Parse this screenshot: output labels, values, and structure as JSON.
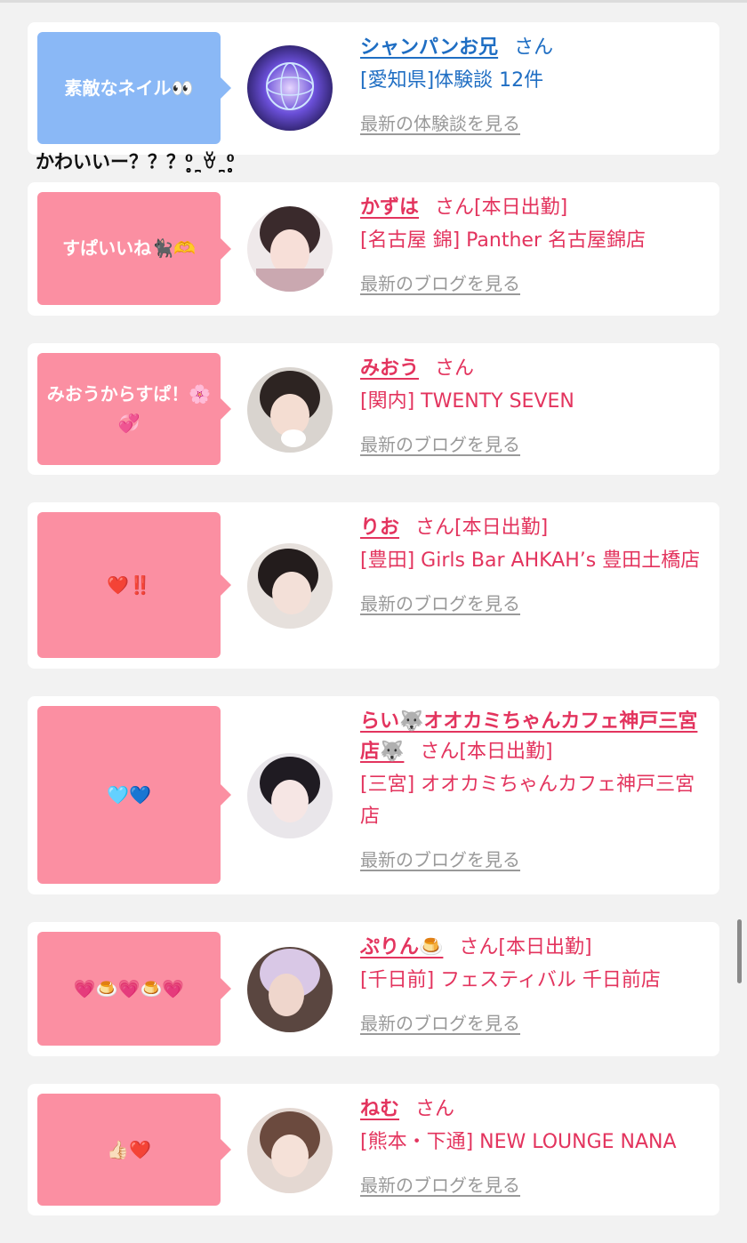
{
  "caption": "かわいいー？？？⁰̥̥̥̥̥̥̥̥̥̥ˍ̯ꈊˍ̯⁰̥̥̥̥̥̥̥̥̥̥",
  "san_label": "さん",
  "cards": [
    {
      "bubble_text": "素敵なネイル👀",
      "bubble_color": "blue",
      "name": "シャンパンお兄",
      "status": "",
      "shop": "[愛知県]体験談 12件",
      "link": "最新の体験談を見る"
    },
    {
      "bubble_text": "すぱいいね🐈‍⬛🫶",
      "bubble_color": "pink",
      "name": "かずは",
      "status": "[本日出勤]",
      "shop": "[名古屋 錦] Panther 名古屋錦店",
      "link": "最新のブログを見る"
    },
    {
      "bubble_text": "みおうからすぱ！🌸💞",
      "bubble_color": "pink",
      "name": "みおう",
      "status": "",
      "shop": "[関内] TWENTY SEVEN",
      "link": "最新のブログを見る"
    },
    {
      "bubble_text": "❤️‼️",
      "bubble_color": "pink",
      "name": "りお",
      "status": "[本日出勤]",
      "shop": "[豊田] Girls Bar AHKAH’s 豊田土橋店",
      "link": "最新のブログを見る"
    },
    {
      "bubble_text": "🩵💙",
      "bubble_color": "pink",
      "name": "らい🐺オオカミちゃんカフェ神戸三宮店🐺",
      "status": "[本日出勤]",
      "shop": "[三宮] オオカミちゃんカフェ神戸三宮店",
      "link": "最新のブログを見る"
    },
    {
      "bubble_text": "💗🍮💗🍮💗",
      "bubble_color": "pink",
      "name": "ぷりん🍮",
      "status": "[本日出勤]",
      "shop": "[千日前] フェスティバル 千日前店",
      "link": "最新のブログを見る"
    },
    {
      "bubble_text": "👍🏻❤️",
      "bubble_color": "pink",
      "name": "ねむ",
      "status": "",
      "shop": "[熊本・下通] NEW LOUNGE NANA",
      "link": "最新のブログを見る"
    }
  ],
  "colors": {
    "page_bg": "#f2f2f2",
    "pink_bubble": "#fb8fa2",
    "blue_bubble": "#8ab8f6",
    "pink_text": "#e3345e",
    "blue_text": "#1f6ec3",
    "link_gray": "#999999"
  }
}
